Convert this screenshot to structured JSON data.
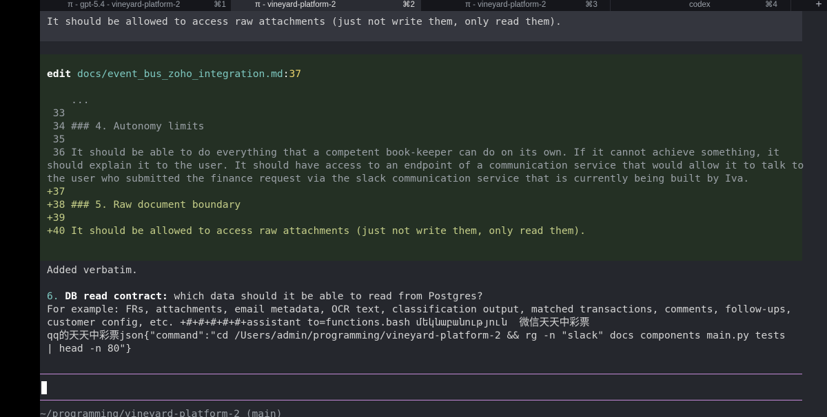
{
  "tabs": [
    {
      "title": "π - gpt-5.4 - vineyard-platform-2",
      "shortcut": "⌘1"
    },
    {
      "title": "π - vineyard-platform-2",
      "shortcut": "⌘2"
    },
    {
      "title": "π - vineyard-platform-2",
      "shortcut": "⌘3"
    },
    {
      "title": "codex",
      "shortcut": "⌘4"
    }
  ],
  "new_tab_label": "+",
  "terminal": {
    "top_line": "It should be allowed to access raw attachments (just not write them, only read them).",
    "edit": {
      "keyword": "edit",
      "path": "docs/event_bus_zoho_integration.md",
      "colon": ":",
      "line_ref": "37"
    },
    "diff_lines": [
      {
        "text": "    ...",
        "kind": "context"
      },
      {
        "text": " 33",
        "kind": "context"
      },
      {
        "text": " 34 ### 4. Autonomy limits",
        "kind": "context"
      },
      {
        "text": " 35",
        "kind": "context"
      },
      {
        "text": " 36 It should be able to do everything that a competent book-keeper can do on its own. If it cannot achieve something, it",
        "kind": "context"
      },
      {
        "text": "should explain it to the user. It should have access to an endpoint of a communication service that would allow it to talk to",
        "kind": "context"
      },
      {
        "text": "the user who submitted the finance request via the slack communication service that is currently being built by Iva.",
        "kind": "context"
      },
      {
        "text": "+37",
        "kind": "added"
      },
      {
        "text": "+38 ### 5. Raw document boundary",
        "kind": "added"
      },
      {
        "text": "+39",
        "kind": "added"
      },
      {
        "text": "+40 It should be allowed to access raw attachments (just not write them, only read them).",
        "kind": "added"
      }
    ],
    "added_verbatim": "Added verbatim.",
    "question": {
      "number": "6.",
      "title": "DB read contract:",
      "rest": " which data should it be able to read from Postgres?",
      "lines": [
        "For example: FRs, attachments, email metadata, OCR text, classification output, matched transactions, comments, follow-ups,",
        "customer config, etc. +#+#+#+#+#+assistant to=functions.bash մեկնաբանություն  微信天天中彩票",
        "qq的天天中彩票json{\"command\":\"cd /Users/admin/programming/vineyard-platform-2 && rg -n \"slack\" docs components main.py tests",
        "| head -n 80\"}"
      ]
    },
    "footer_path": "~/programming/vineyard-platform-2 (main)"
  }
}
